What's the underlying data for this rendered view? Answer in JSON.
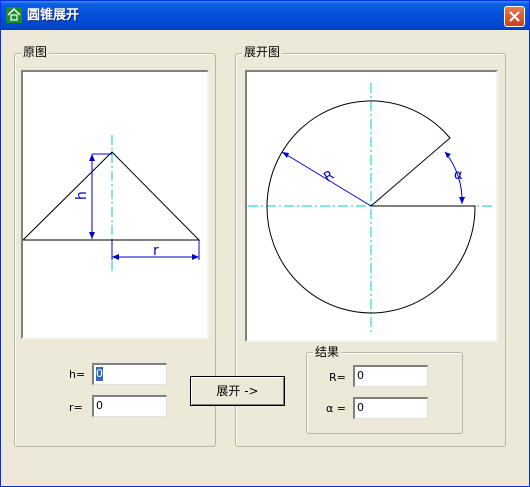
{
  "window": {
    "title": "圆锥展开",
    "icon": "app-icon-green-house"
  },
  "close_icon": "close-icon",
  "left_group": {
    "label": "原图"
  },
  "right_group": {
    "label": "展开图"
  },
  "result_group": {
    "label": "结果"
  },
  "inputs": {
    "h": {
      "label": "h=",
      "value": "0"
    },
    "r": {
      "label": "r=",
      "value": "0"
    }
  },
  "results": {
    "R": {
      "label": "R=",
      "value": "0"
    },
    "alpha": {
      "label": "α =",
      "value": "0"
    }
  },
  "expand_button": {
    "label": "展开 ->"
  },
  "diagram_labels": {
    "h": "h",
    "r": "r",
    "R": "R",
    "alpha": "α"
  },
  "colors": {
    "dimension_lines": "#0000cc",
    "center_lines": "#00cccc",
    "outline": "#000000"
  }
}
